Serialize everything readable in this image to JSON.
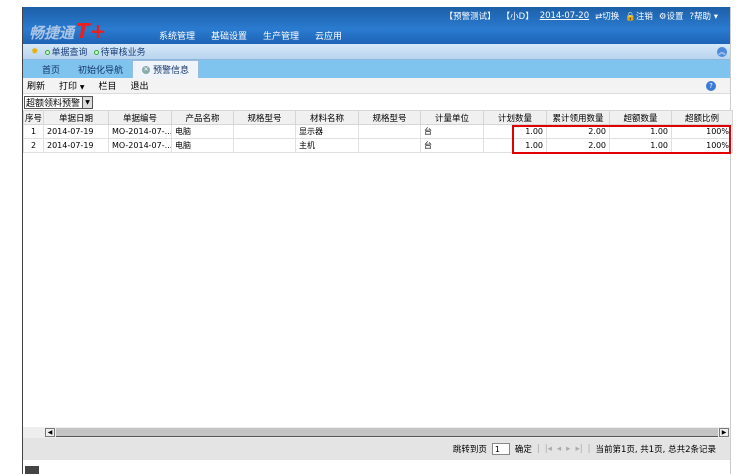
{
  "header": {
    "logo": "畅捷通",
    "logo_mark": "T+",
    "nav": [
      "系统管理",
      "基础设置",
      "生产管理",
      "云应用"
    ],
    "account": "【预警测试】",
    "user": "【小D】",
    "date": "2014-07-20",
    "switch": "切换",
    "logout": "注销",
    "settings": "设置",
    "help": "帮助"
  },
  "quick": {
    "items": [
      "单据查询",
      "待审核业务"
    ]
  },
  "tabs": [
    {
      "label": "首页"
    },
    {
      "label": "初始化导航"
    },
    {
      "label": "预警信息"
    }
  ],
  "toolbar": {
    "refresh": "刷新",
    "print": "打印",
    "columns": "栏目",
    "exit": "退出"
  },
  "filter": {
    "selected": "超额领料预警"
  },
  "table": {
    "columns": [
      "序号",
      "单据日期",
      "单据编号",
      "产品名称",
      "规格型号",
      "材料名称",
      "规格型号",
      "计量单位",
      "计划数量",
      "累计领用数量",
      "超额数量",
      "超额比例"
    ],
    "rows": [
      [
        "1",
        "2014-07-19",
        "MO-2014-07-...",
        "电脑",
        "",
        "显示器",
        "",
        "台",
        "1.00",
        "2.00",
        "1.00",
        "100%"
      ],
      [
        "2",
        "2014-07-19",
        "MO-2014-07-...",
        "电脑",
        "",
        "主机",
        "",
        "台",
        "1.00",
        "2.00",
        "1.00",
        "100%"
      ]
    ]
  },
  "pager": {
    "goto": "跳转到页",
    "page": "1",
    "confirm": "确定",
    "status": "当前第1页, 共1页, 总共2条记录"
  },
  "colors": {
    "highlight": "#e00000",
    "header": "#2a7bd0"
  }
}
